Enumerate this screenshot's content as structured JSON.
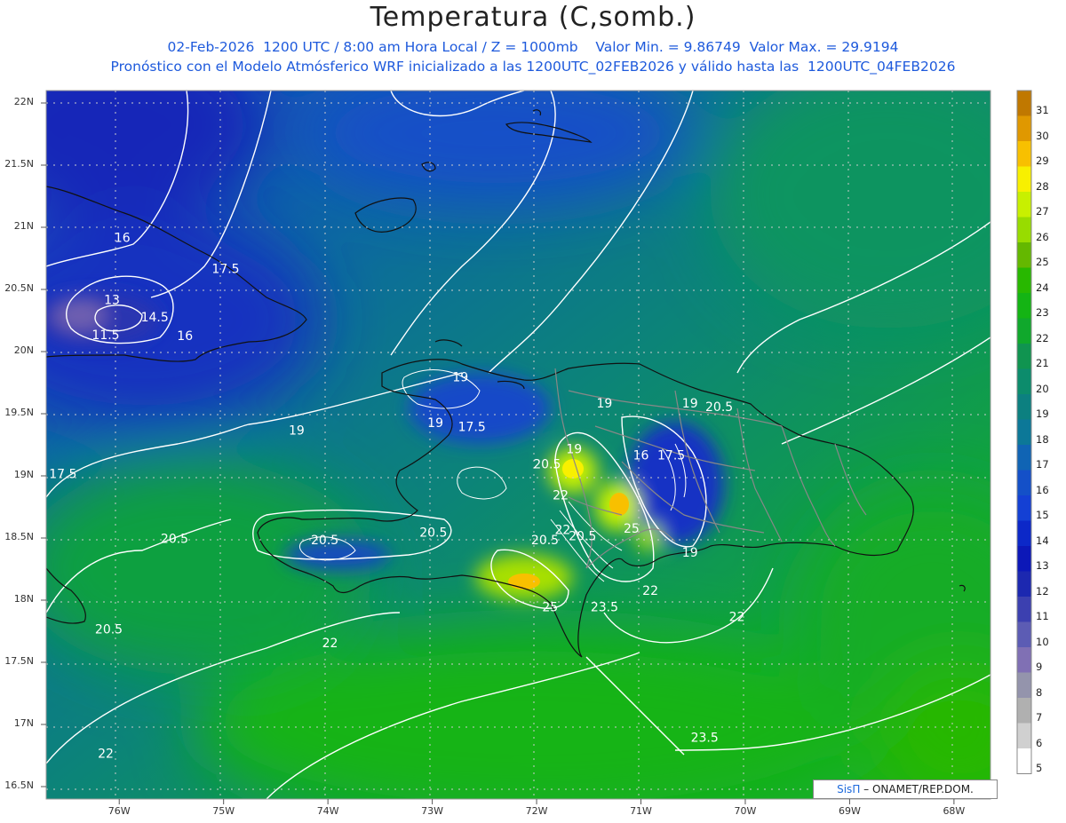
{
  "header": {
    "title": "Temperatura (C,somb.)",
    "line1": "02-Feb-2026  1200 UTC / 8:00 am Hora Local / Z = 1000mb    Valor Min. = 9.86749  Valor Max. = 29.9194",
    "line2": "Pronóstico con el Modelo Atmósferico WRF inicializado a las 1200UTC_02FEB2026 y válido hasta las  1200UTC_04FEB2026"
  },
  "axes": {
    "lat_labels": [
      "22N",
      "21.5N",
      "21N",
      "20.5N",
      "20N",
      "19.5N",
      "19N",
      "18.5N",
      "18N",
      "17.5N",
      "17N",
      "16.5N"
    ],
    "lon_labels": [
      "76W",
      "75W",
      "74W",
      "73W",
      "72W",
      "71W",
      "70W",
      "69W",
      "68W"
    ],
    "lat_range": [
      16.4,
      22.1
    ],
    "lon_range": [
      -76.7,
      -67.65
    ],
    "grid": true
  },
  "colorbar": {
    "levels": [
      "31",
      "30",
      "29",
      "28",
      "27",
      "26",
      "25",
      "24",
      "23",
      "22",
      "21",
      "20",
      "19",
      "18",
      "17",
      "16",
      "15",
      "14",
      "13",
      "12",
      "11",
      "10",
      "9",
      "8",
      "7",
      "6",
      "5"
    ],
    "colors": [
      "#c07800",
      "#e09800",
      "#f8c000",
      "#f8f000",
      "#c8f000",
      "#98dc00",
      "#64b800",
      "#28b800",
      "#14b414",
      "#10a82c",
      "#109450",
      "#0c8c6c",
      "#0c8080",
      "#0c7898",
      "#1064b4",
      "#1450c8",
      "#1440d4",
      "#0c28c8",
      "#0c18b8",
      "#1c28b0",
      "#3c40b0",
      "#5c5cb4",
      "#8070b4",
      "#9494ac",
      "#b0b0b0",
      "#d0d0d0",
      "#ffffff"
    ]
  },
  "contour_labels": [
    {
      "text": "16",
      "lon": -75.97,
      "lat": 20.91
    },
    {
      "text": "17.5",
      "lon": -74.98,
      "lat": 20.66
    },
    {
      "text": "13",
      "lon": -76.07,
      "lat": 20.41
    },
    {
      "text": "14.5",
      "lon": -75.66,
      "lat": 20.27
    },
    {
      "text": "11.5",
      "lon": -76.13,
      "lat": 20.13
    },
    {
      "text": "16",
      "lon": -75.37,
      "lat": 20.12
    },
    {
      "text": "19",
      "lon": -72.73,
      "lat": 19.79
    },
    {
      "text": "19",
      "lon": -72.97,
      "lat": 19.42
    },
    {
      "text": "17.5",
      "lon": -72.62,
      "lat": 19.39
    },
    {
      "text": "19",
      "lon": -74.3,
      "lat": 19.36
    },
    {
      "text": "17.5",
      "lon": -76.54,
      "lat": 19.01
    },
    {
      "text": "19",
      "lon": -71.35,
      "lat": 19.58
    },
    {
      "text": "19",
      "lon": -70.53,
      "lat": 19.58
    },
    {
      "text": "20.5",
      "lon": -70.25,
      "lat": 19.55
    },
    {
      "text": "19",
      "lon": -71.64,
      "lat": 19.21
    },
    {
      "text": "16",
      "lon": -71.0,
      "lat": 19.16
    },
    {
      "text": "17.5",
      "lon": -70.71,
      "lat": 19.16
    },
    {
      "text": "20.5",
      "lon": -71.9,
      "lat": 19.09
    },
    {
      "text": "22",
      "lon": -71.77,
      "lat": 18.84
    },
    {
      "text": "20.5",
      "lon": -72.99,
      "lat": 18.54
    },
    {
      "text": "22",
      "lon": -71.75,
      "lat": 18.56
    },
    {
      "text": "20.5",
      "lon": -71.56,
      "lat": 18.51
    },
    {
      "text": "25",
      "lon": -71.09,
      "lat": 18.57
    },
    {
      "text": "20.5",
      "lon": -75.47,
      "lat": 18.49
    },
    {
      "text": "20.5",
      "lon": -74.03,
      "lat": 18.48
    },
    {
      "text": "20.5",
      "lon": -71.92,
      "lat": 18.48
    },
    {
      "text": "19",
      "lon": -70.53,
      "lat": 18.38
    },
    {
      "text": "22",
      "lon": -70.91,
      "lat": 18.07
    },
    {
      "text": "25",
      "lon": -71.87,
      "lat": 17.94
    },
    {
      "text": "23.5",
      "lon": -71.35,
      "lat": 17.94
    },
    {
      "text": "22",
      "lon": -70.08,
      "lat": 17.86
    },
    {
      "text": "20.5",
      "lon": -76.1,
      "lat": 17.76
    },
    {
      "text": "22",
      "lon": -73.98,
      "lat": 17.65
    },
    {
      "text": "23.5",
      "lon": -70.39,
      "lat": 16.89
    },
    {
      "text": "22",
      "lon": -76.13,
      "lat": 16.76
    }
  ],
  "credit": {
    "brand": "SisΠ",
    "text": " – ONAMET/REP.DOM."
  }
}
